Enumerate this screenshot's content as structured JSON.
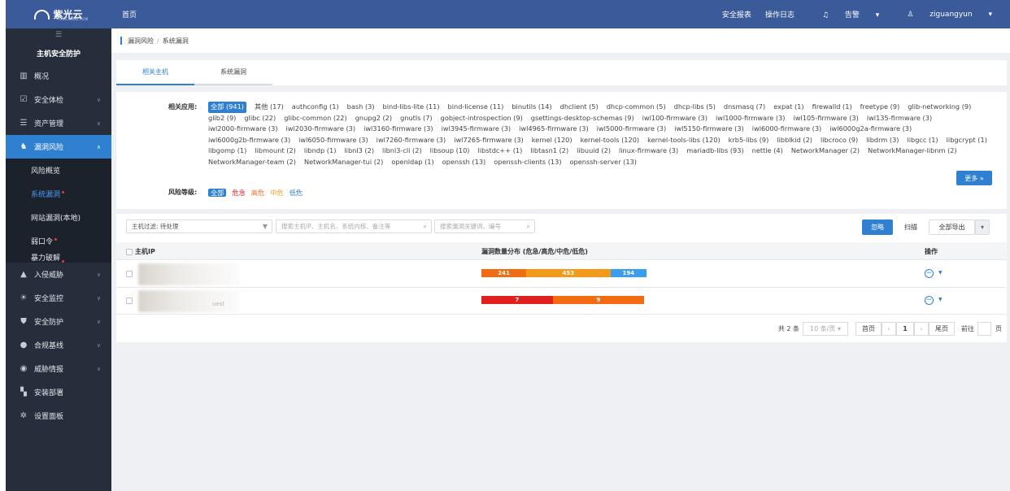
{
  "brand": {
    "name": "紫光云",
    "sub": "UNICLOUD.COM"
  },
  "sidebar": {
    "collapse_glyph": "☰",
    "title": "主机安全防护",
    "items": [
      {
        "label": "概况",
        "icon": "chart-icon"
      },
      {
        "label": "安全体检",
        "icon": "checkup-icon"
      },
      {
        "label": "资产管理",
        "icon": "asset-icon"
      },
      {
        "label": "漏洞风险",
        "icon": "vuln-icon"
      },
      {
        "label": "入侵威胁",
        "icon": "intrusion-icon"
      },
      {
        "label": "安全监控",
        "icon": "monitor-icon"
      },
      {
        "label": "安全防护",
        "icon": "shield-icon"
      },
      {
        "label": "合规基线",
        "icon": "baseline-icon"
      },
      {
        "label": "威胁情报",
        "icon": "intel-icon"
      },
      {
        "label": "安装部署",
        "icon": "deploy-icon"
      },
      {
        "label": "设置面板",
        "icon": "settings-icon"
      }
    ],
    "sub_items": [
      "风险概览",
      "系统漏洞",
      "网站漏洞(本地)",
      "弱口令",
      "暴力破解"
    ]
  },
  "topbar": {
    "home": "首页",
    "report": "安全报表",
    "oplog": "操作日志",
    "alarm": "告警",
    "user": "ziguangyun"
  },
  "breadcrumb": {
    "parent": "漏洞风险",
    "current": "系统漏洞"
  },
  "tabs": [
    "相关主机",
    "系统漏洞"
  ],
  "filters": {
    "apps_label": "相关应用:",
    "apps": [
      "全部 (941)",
      "其他 (17)",
      "authconfig (1)",
      "bash (3)",
      "bind-libs-lite (11)",
      "bind-license (11)",
      "binutils (14)",
      "dhclient (5)",
      "dhcp-common (5)",
      "dhcp-libs (5)",
      "dnsmasq (7)",
      "expat (1)",
      "firewalld (1)",
      "freetype (9)",
      "glib-networking (9)",
      "glib2 (9)",
      "glibc (22)",
      "glibc-common (22)",
      "gnupg2 (2)",
      "gnutls (7)",
      "gobject-introspection (9)",
      "gsettings-desktop-schemas (9)",
      "iwl100-firmware (3)",
      "iwl1000-firmware (3)",
      "iwl105-firmware (3)",
      "iwl135-firmware (3)",
      "iwl2000-firmware (3)",
      "iwl2030-firmware (3)",
      "iwl3160-firmware (3)",
      "iwl3945-firmware (3)",
      "iwl4965-firmware (3)",
      "iwl5000-firmware (3)",
      "iwl5150-firmware (3)",
      "iwl6000-firmware (3)",
      "iwl6000g2a-firmware (3)",
      "iwl6000g2b-firmware (3)",
      "iwl6050-firmware (3)",
      "iwl7260-firmware (3)",
      "iwl7265-firmware (3)",
      "kernel (120)",
      "kernel-tools (120)",
      "kernel-tools-libs (120)",
      "krb5-libs (9)",
      "libblkid (2)",
      "libcroco (9)",
      "libdrm (3)",
      "libgcc (1)",
      "libgcrypt (1)",
      "libgomp (1)",
      "libmount (2)",
      "libndp (1)",
      "libnl3 (2)",
      "libnl3-cli (2)",
      "libsoup (10)",
      "libstdc++ (1)",
      "libtasn1 (2)",
      "libuuid (2)",
      "linux-firmware (3)",
      "mariadb-libs (93)",
      "nettle (4)",
      "NetworkManager (2)",
      "NetworkManager-libnm (2)",
      "NetworkManager-team (2)",
      "NetworkManager-tui (2)",
      "openldap (1)",
      "openssh (13)",
      "openssh-clients (13)",
      "openssh-server (13)"
    ],
    "more": "更多",
    "risk_label": "风险等级:",
    "risk_levels": [
      {
        "label": "全部",
        "color": "#ffffff"
      },
      {
        "label": "危急",
        "color": "#e02020"
      },
      {
        "label": "高危",
        "color": "#f26b2b"
      },
      {
        "label": "中危",
        "color": "#f2a21d"
      },
      {
        "label": "低危",
        "color": "#2f80d1"
      }
    ]
  },
  "toolbar": {
    "host_filter": "主机过滤: 待处理",
    "search_host_placeholder": "搜索主机IP、主机名、系统内核、备注等",
    "search_vuln_placeholder": "搜索漏洞关键词、编号",
    "ignore": "忽略",
    "scan": "扫描",
    "export": "全部导出"
  },
  "table": {
    "headers": [
      "主机IP",
      "漏洞数量分布 (危急/高危/中危/低危)",
      "操作"
    ],
    "rows": [
      {
        "host_tail": "",
        "segments": [
          {
            "value": 241,
            "color": "#f26b10"
          },
          {
            "value": 453,
            "color": "#f59a18"
          },
          {
            "value": 194,
            "color": "#3a9ef0"
          }
        ]
      },
      {
        "host_tail": "uest",
        "segments": [
          {
            "value": 7,
            "color": "#e0201e"
          },
          {
            "value": 9,
            "color": "#f26b10"
          }
        ]
      }
    ]
  },
  "pager": {
    "total": "共 2 条",
    "page_size": "10 条/页",
    "first": "首页",
    "current": "1",
    "last": "尾页",
    "goto": "前往",
    "page_unit": "页"
  },
  "colors": {
    "primary": "#2f80d1",
    "topbar": "#3a5a99",
    "sidebar": "#262e3c"
  }
}
